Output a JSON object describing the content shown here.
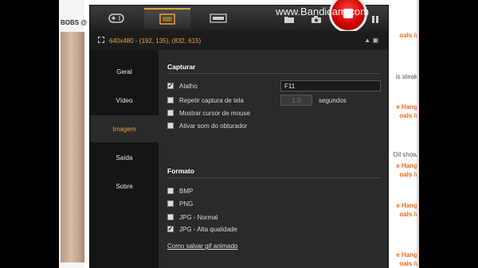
{
  "watermark": "www.Bandicam.com",
  "info": {
    "resolution": "640x480 - (192, 135), (832, 615)"
  },
  "background": {
    "bobs": "BOBS @",
    "links": [
      "oals //",
      "is steak",
      "e Hang",
      "oals //",
      "Oil show",
      "e Hang",
      "oals //",
      "e Hang",
      "oals //",
      "e Hang",
      "oals //"
    ]
  },
  "sidebar": {
    "items": [
      {
        "label": "Geral",
        "active": false
      },
      {
        "label": "Vídeo",
        "active": false
      },
      {
        "label": "Imagem",
        "active": true
      },
      {
        "label": "Saída",
        "active": false
      },
      {
        "label": "Sobre",
        "active": false
      }
    ]
  },
  "capture": {
    "title": "Capturar",
    "hotkey_label": "Atalho",
    "hotkey_value": "F11",
    "repeat_label": "Repetir captura de tela",
    "repeat_value": "1.0",
    "repeat_unit": "segundos",
    "cursor_label": "Mostrar cursor de mouse",
    "shutter_label": "Ativar som do obturador"
  },
  "format": {
    "title": "Formato",
    "options": [
      "BMP",
      "PNG",
      "JPG - Normal",
      "JPG - Alta qualidade"
    ],
    "gif_link": "Como salvar gif animado"
  },
  "colors": {
    "accent": "#e8a23a",
    "record": "#d40000",
    "panel": "#2a2a2a"
  }
}
